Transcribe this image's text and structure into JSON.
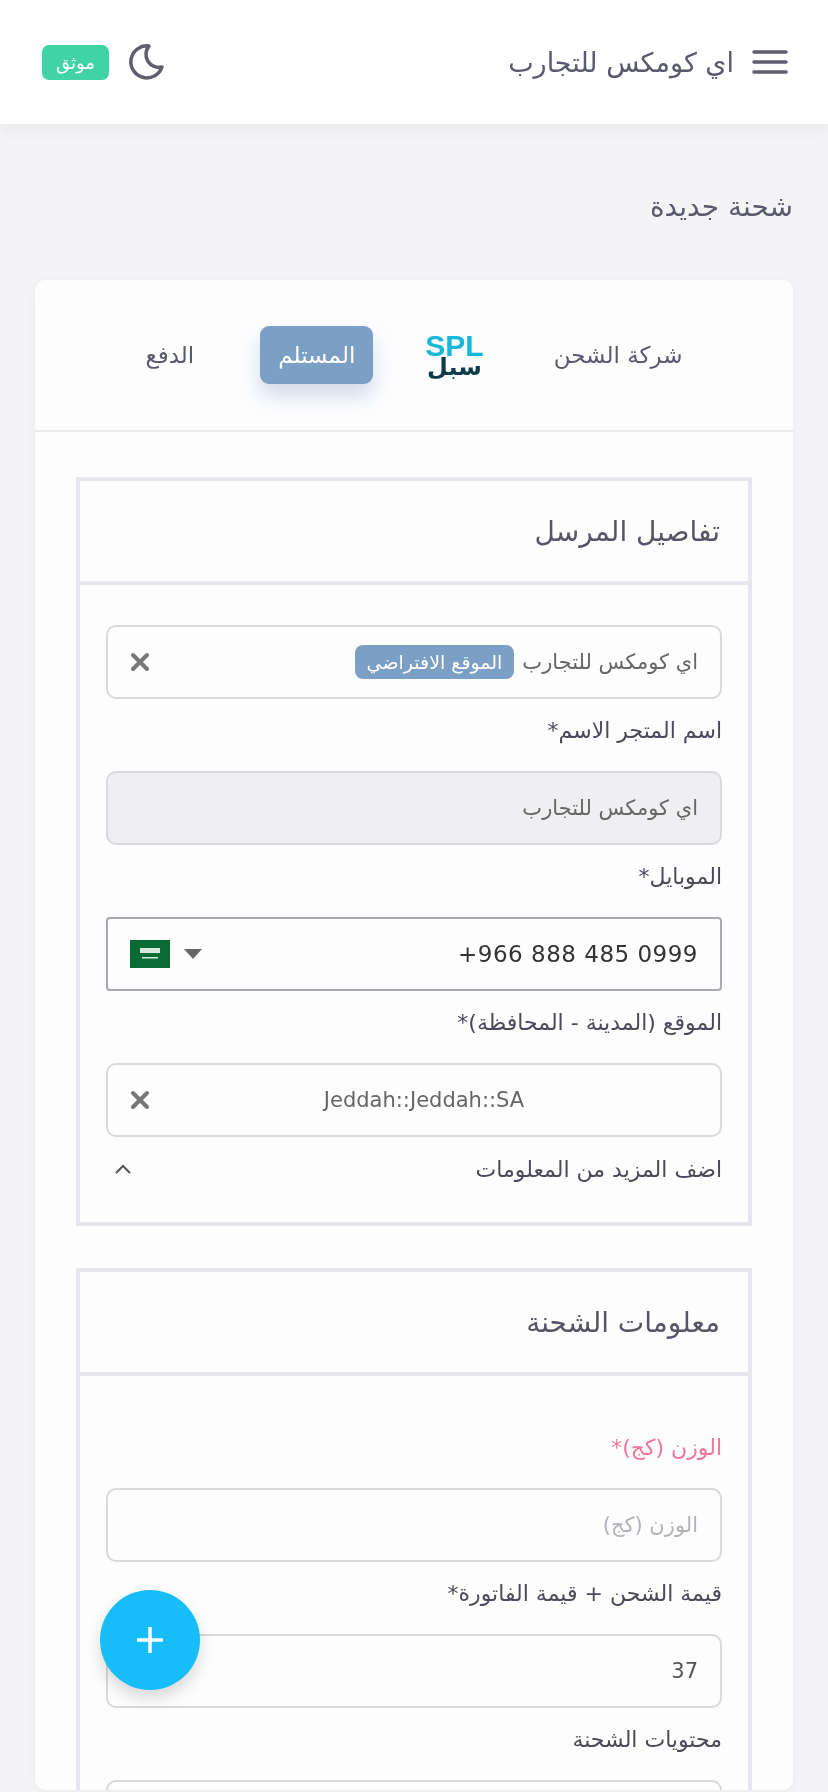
{
  "header": {
    "title": "اي كومكس للتجارب",
    "badge": "موثق"
  },
  "page_title": "شحنة جديدة",
  "tabs": [
    {
      "kind": "text",
      "label": "شركة الشحن",
      "selected": false
    },
    {
      "kind": "logo",
      "label": "SPL",
      "sublabel": "سبل",
      "selected": false
    },
    {
      "kind": "text",
      "label": "المستلم",
      "selected": true
    },
    {
      "kind": "text",
      "label": "الدفع",
      "selected": false
    }
  ],
  "sections": [
    {
      "title": "تفاصيل المرسل",
      "fields": [
        {
          "kind": "select",
          "value": "اي كومكس للتجارب",
          "tag": "الموقع الافتراضي",
          "clearable": true
        },
        {
          "kind": "text",
          "label": "اسم المتجر الاسم*",
          "value": "اي كومكس للتجارب",
          "disabled": true
        },
        {
          "kind": "phone",
          "label": "الموبايل*",
          "value": "+966 888 485 0999"
        },
        {
          "kind": "select",
          "label": "الموقع (المدينة - المحافظة)*",
          "value": "Jeddah::Jeddah::SA",
          "clearable": true
        },
        {
          "kind": "toggle",
          "label": "اضف المزيد من المعلومات",
          "expanded": true
        }
      ]
    },
    {
      "title": "معلومات الشحنة",
      "fields": [
        {
          "kind": "text",
          "label": "الوزن (كج)*",
          "placeholder": "الوزن (كج)",
          "invalid": true
        },
        {
          "kind": "text",
          "label": "قيمة الشحن + قيمة الفاتورة*",
          "value": "37"
        },
        {
          "kind": "text",
          "label": "محتويات الشحنة"
        }
      ]
    }
  ]
}
